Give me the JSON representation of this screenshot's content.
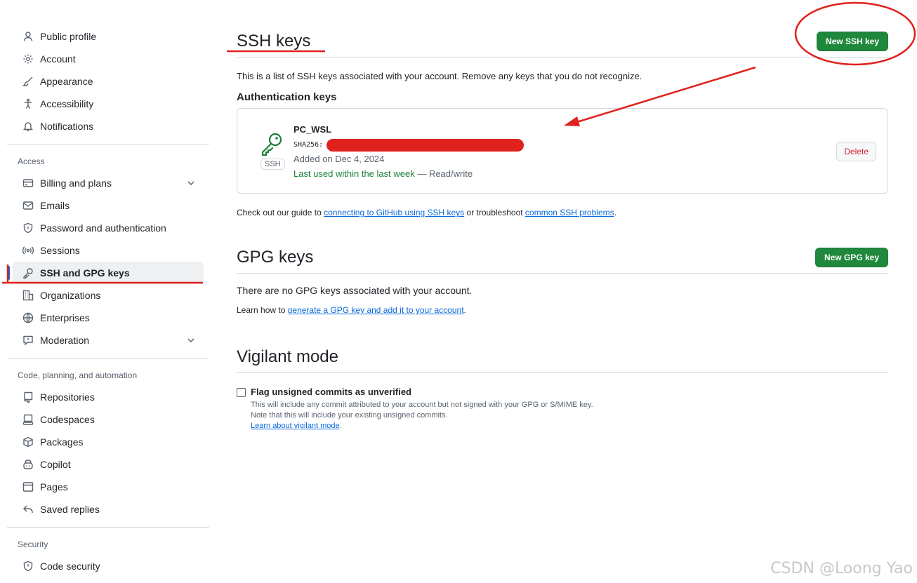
{
  "sidebar": {
    "top_items": [
      {
        "label": "Public profile",
        "icon": "person-icon"
      },
      {
        "label": "Account",
        "icon": "gear-icon"
      },
      {
        "label": "Appearance",
        "icon": "paintbrush-icon"
      },
      {
        "label": "Accessibility",
        "icon": "accessibility-icon"
      },
      {
        "label": "Notifications",
        "icon": "bell-icon"
      }
    ],
    "access_title": "Access",
    "access_items": [
      {
        "label": "Billing and plans",
        "icon": "credit-card-icon",
        "expandable": true
      },
      {
        "label": "Emails",
        "icon": "mail-icon"
      },
      {
        "label": "Password and authentication",
        "icon": "shield-lock-icon"
      },
      {
        "label": "Sessions",
        "icon": "broadcast-icon"
      },
      {
        "label": "SSH and GPG keys",
        "icon": "key-icon",
        "active": true
      },
      {
        "label": "Organizations",
        "icon": "organization-icon"
      },
      {
        "label": "Enterprises",
        "icon": "globe-icon"
      },
      {
        "label": "Moderation",
        "icon": "report-icon",
        "expandable": true
      }
    ],
    "code_title": "Code, planning, and automation",
    "code_items": [
      {
        "label": "Repositories",
        "icon": "repo-icon"
      },
      {
        "label": "Codespaces",
        "icon": "codespaces-icon"
      },
      {
        "label": "Packages",
        "icon": "package-icon"
      },
      {
        "label": "Copilot",
        "icon": "copilot-icon"
      },
      {
        "label": "Pages",
        "icon": "browser-icon"
      },
      {
        "label": "Saved replies",
        "icon": "reply-icon"
      }
    ],
    "security_title": "Security",
    "security_items": [
      {
        "label": "Code security",
        "icon": "shield-check-icon"
      }
    ]
  },
  "ssh": {
    "title": "SSH keys",
    "new_button": "New SSH key",
    "description": "This is a list of SSH keys associated with your account. Remove any keys that you do not recognize.",
    "auth_title": "Authentication keys",
    "key": {
      "name": "PC_WSL",
      "sha_prefix": "SHA256:",
      "badge": "SSH",
      "added": "Added on Dec 4, 2024",
      "last_used": "Last used within the last week",
      "access": " — Read/write",
      "delete_label": "Delete"
    },
    "guide_prefix": "Check out our guide to ",
    "guide_link": "connecting to GitHub using SSH keys",
    "guide_middle": " or troubleshoot ",
    "guide_link2": "common SSH problems",
    "guide_suffix": "."
  },
  "gpg": {
    "title": "GPG keys",
    "new_button": "New GPG key",
    "empty_text": "There are no GPG keys associated with your account.",
    "learn_prefix": "Learn how to ",
    "learn_link": "generate a GPG key and add it to your account",
    "learn_suffix": "."
  },
  "vigilant": {
    "title": "Vigilant mode",
    "checkbox_label": "Flag unsigned commits as unverified",
    "checked": false,
    "desc1": "This will include any commit attributed to your account but not signed with your GPG or S/MIME key.",
    "desc2": "Note that this will include your existing unsigned commits.",
    "learn_link": "Learn about vigilant mode",
    "learn_suffix": "."
  },
  "watermark": "CSDN @Loong Yao",
  "colors": {
    "accent_green": "#1f883d",
    "annotation_red": "#e0211d",
    "active_blue": "#0969da"
  }
}
